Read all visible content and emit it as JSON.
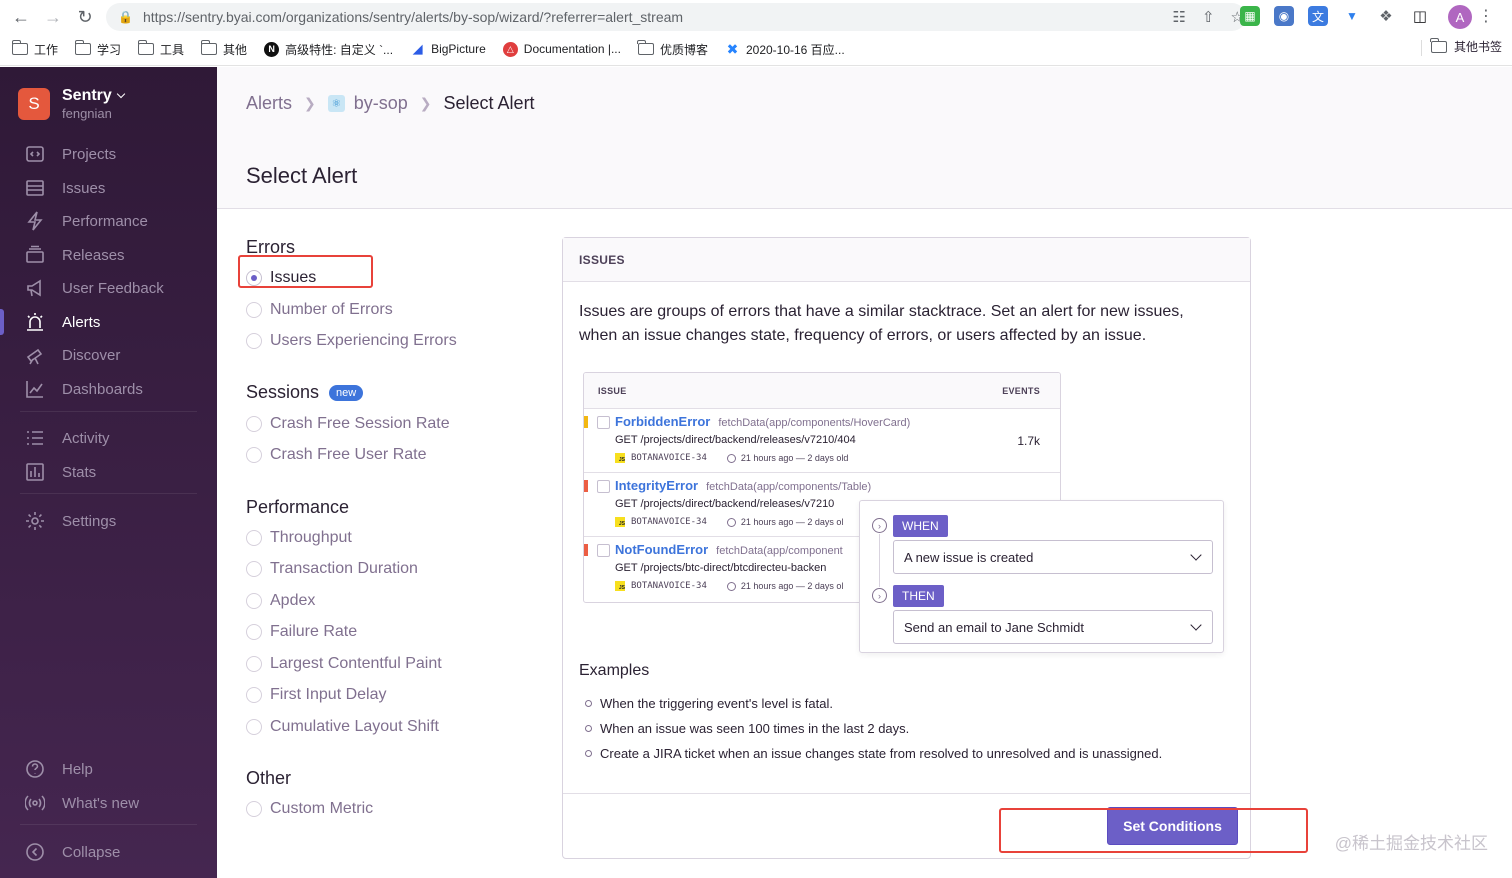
{
  "browser": {
    "url_host": "https://sentry.byai.com",
    "url_path": "/organizations/sentry/alerts/by-sop/wizard/?referrer=alert_stream",
    "bookmarks": [
      {
        "label": "工作",
        "icon": "folder-icon"
      },
      {
        "label": "学习",
        "icon": "folder-icon"
      },
      {
        "label": "工具",
        "icon": "folder-icon"
      },
      {
        "label": "其他",
        "icon": "folder-icon"
      },
      {
        "label": "高级特性: 自定义 `...",
        "icon": "notion-icon"
      },
      {
        "label": "BigPicture",
        "icon": "bigpicture-icon"
      },
      {
        "label": "Documentation |...",
        "icon": "sentry-doc-icon"
      },
      {
        "label": "优质博客",
        "icon": "folder-icon"
      },
      {
        "label": "2020-10-16 百应...",
        "icon": "confluence-icon"
      }
    ],
    "other_bookmarks": "其他书签",
    "profile_initial": "A"
  },
  "sidebar": {
    "org_initial": "S",
    "org_name": "Sentry",
    "org_user": "fengnian",
    "items": [
      {
        "label": "Projects",
        "icon": "projects-icon"
      },
      {
        "label": "Issues",
        "icon": "issues-icon"
      },
      {
        "label": "Performance",
        "icon": "lightning-icon"
      },
      {
        "label": "Releases",
        "icon": "releases-icon"
      },
      {
        "label": "User Feedback",
        "icon": "megaphone-icon"
      },
      {
        "label": "Alerts",
        "icon": "siren-icon"
      },
      {
        "label": "Discover",
        "icon": "telescope-icon"
      },
      {
        "label": "Dashboards",
        "icon": "graph-icon"
      },
      {
        "label": "Activity",
        "icon": "list-icon"
      },
      {
        "label": "Stats",
        "icon": "bar-chart-icon"
      },
      {
        "label": "Settings",
        "icon": "gear-icon"
      }
    ],
    "help": "Help",
    "whats_new": "What's new",
    "collapse": "Collapse"
  },
  "breadcrumb": {
    "root": "Alerts",
    "project": "by-sop",
    "current": "Select Alert"
  },
  "page_title": "Select Alert",
  "groups": {
    "errors": {
      "title": "Errors",
      "options": [
        "Issues",
        "Number of Errors",
        "Users Experiencing Errors"
      ],
      "selected": "Issues"
    },
    "sessions": {
      "title": "Sessions",
      "badge": "new",
      "options": [
        "Crash Free Session Rate",
        "Crash Free User Rate"
      ]
    },
    "performance": {
      "title": "Performance",
      "options": [
        "Throughput",
        "Transaction Duration",
        "Apdex",
        "Failure Rate",
        "Largest Contentful Paint",
        "First Input Delay",
        "Cumulative Layout Shift"
      ]
    },
    "other": {
      "title": "Other",
      "options": [
        "Custom Metric"
      ]
    }
  },
  "panel": {
    "header": "ISSUES",
    "description": "Issues are groups of errors that have a similar stacktrace. Set an alert for new issues, when an issue changes state, frequency of errors, or users affected by an issue.",
    "table": {
      "col_issue": "ISSUE",
      "col_events": "EVENTS",
      "rows": [
        {
          "name": "ForbiddenError",
          "culprit": "fetchData(app/components/HoverCard)",
          "path": "GET /projects/direct/backend/releases/v7210/404",
          "project": "BOTANAVOICE-34",
          "age": "21 hours ago — 2 days old",
          "events": "1.7k",
          "color": "#f2b712"
        },
        {
          "name": "IntegrityError",
          "culprit": "fetchData(app/components/Table)",
          "path": "GET /projects/direct/backend/releases/v7210",
          "project": "BOTANAVOICE-34",
          "age": "21 hours ago — 2 days ol",
          "events": "",
          "color": "#ec5e44"
        },
        {
          "name": "NotFoundError",
          "culprit": "fetchData(app/component",
          "path": "GET /projects/btc-direct/btcdirecteu-backen",
          "project": "BOTANAVOICE-34",
          "age": "21 hours ago — 2 days ol",
          "events": "",
          "color": "#ec5e44"
        }
      ]
    },
    "rule": {
      "when_label": "WHEN",
      "when_value": "A new issue is created",
      "then_label": "THEN",
      "then_value": "Send an email to Jane Schmidt"
    },
    "examples_title": "Examples",
    "examples": [
      "When the triggering event's level is fatal.",
      "When an issue was seen 100 times in the last 2 days.",
      "Create a JIRA ticket when an issue changes state from resolved to unresolved and is unassigned."
    ],
    "cta": "Set Conditions"
  },
  "watermark": "@稀土掘金技术社区",
  "colors": {
    "accent": "#6c5fc7",
    "highlight": "#e8423a",
    "sidebar": "#2f1937"
  }
}
